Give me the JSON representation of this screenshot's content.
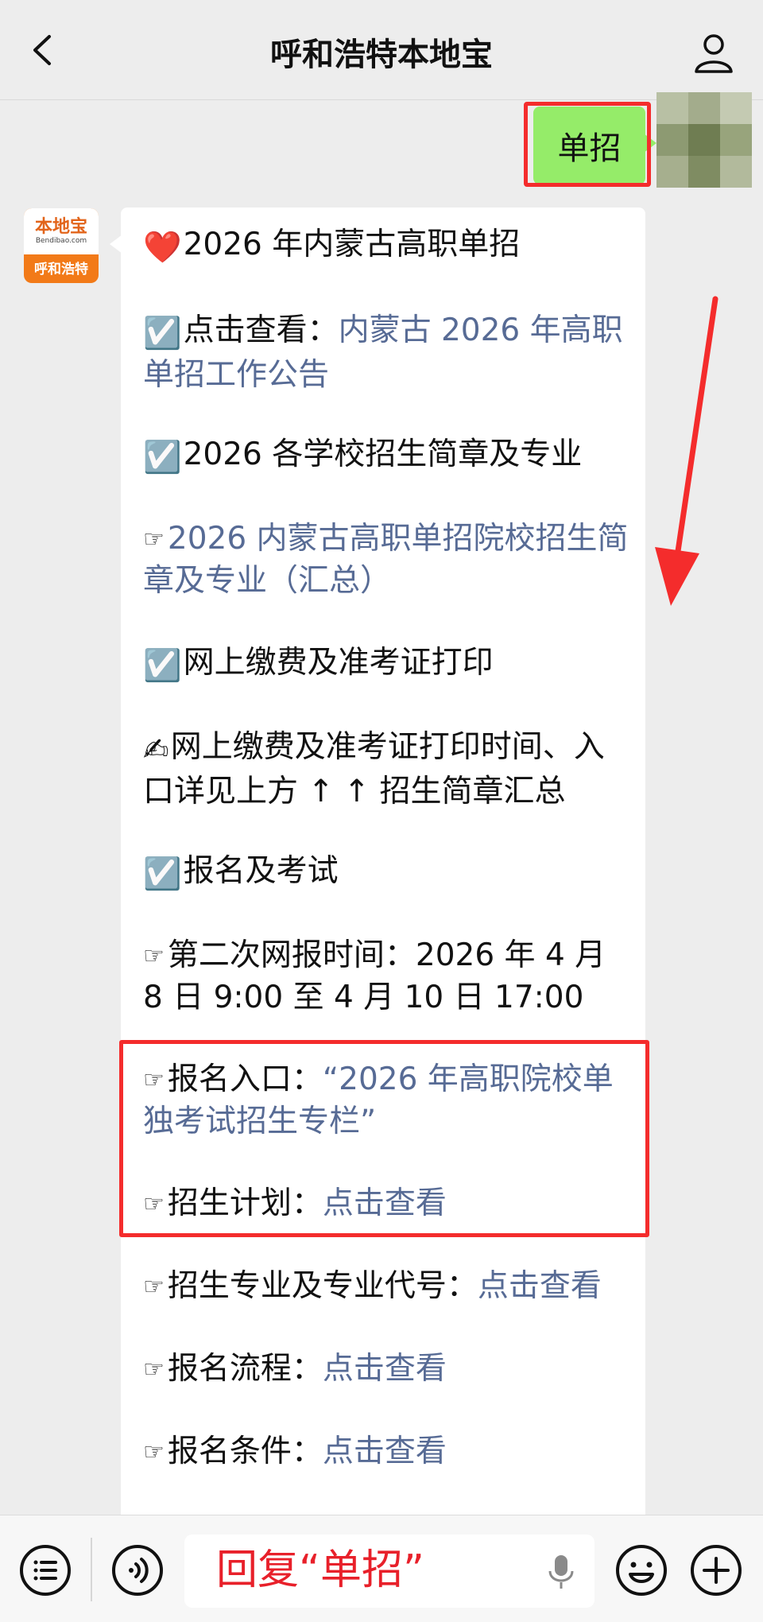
{
  "header": {
    "title": "呼和浩特本地宝"
  },
  "outgoing": {
    "text": "单招"
  },
  "bot": {
    "logo_text": "本地宝",
    "domain_text": "Bendibao.com",
    "city_text": "呼和浩特"
  },
  "message": {
    "title_emoji": "❤️",
    "title": "2026 年内蒙古高职单招",
    "check_emoji": "☑️",
    "item1_prefix": "点击查看：",
    "item1_link": "内蒙古 2026 年高职单招工作公告",
    "item2": "2026 各学校招生简章及专业",
    "hand": "☞",
    "item2_link": "2026 内蒙古高职单招院校招生简章及专业（汇总）",
    "item3": "网上缴费及准考证打印",
    "write_emoji": "✍",
    "item3_detail": "网上缴费及准考证打印时间、入口详见上方 ↑ ↑ 招生简章汇总",
    "item4": "报名及考试",
    "time_line": "第二次网报时间：2026 年 4 月 8 日 9:00 至 4 月 10 日 17:00",
    "entry_prefix": "报名入口：",
    "entry_link": "“2026 年高职院校单独考试招生专栏”",
    "plan_prefix": "招生计划：",
    "plan_link": "点击查看",
    "major_prefix": "招生专业及专业代号：",
    "major_link": "点击查看",
    "flow_prefix": "报名流程：",
    "flow_link": "点击查看",
    "cond_prefix": "报名条件：",
    "cond_link": "点击查看"
  },
  "annotation": {
    "reply_hint": "回复“单招”"
  },
  "colors": {
    "link": "#576b95",
    "highlight_red": "#f42c2c",
    "bubble_green": "#95ec69"
  }
}
